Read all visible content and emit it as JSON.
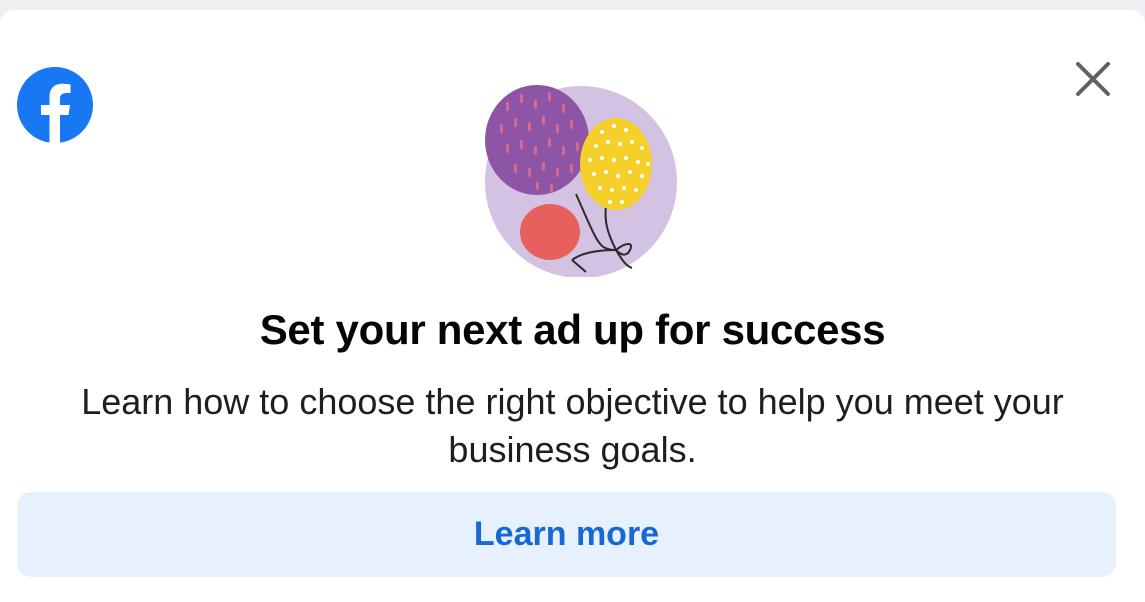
{
  "dialog": {
    "title": "Set your next ad up for success",
    "description": "Learn how to choose the right objective to help you meet your business goals.",
    "cta_label": "Learn more"
  },
  "icons": {
    "logo": "facebook-logo-icon",
    "close": "close-icon",
    "illustration": "balloons-illustration"
  },
  "colors": {
    "brand": "#1877f2",
    "cta_background": "#e7f1fd",
    "cta_text": "#1768d4"
  }
}
